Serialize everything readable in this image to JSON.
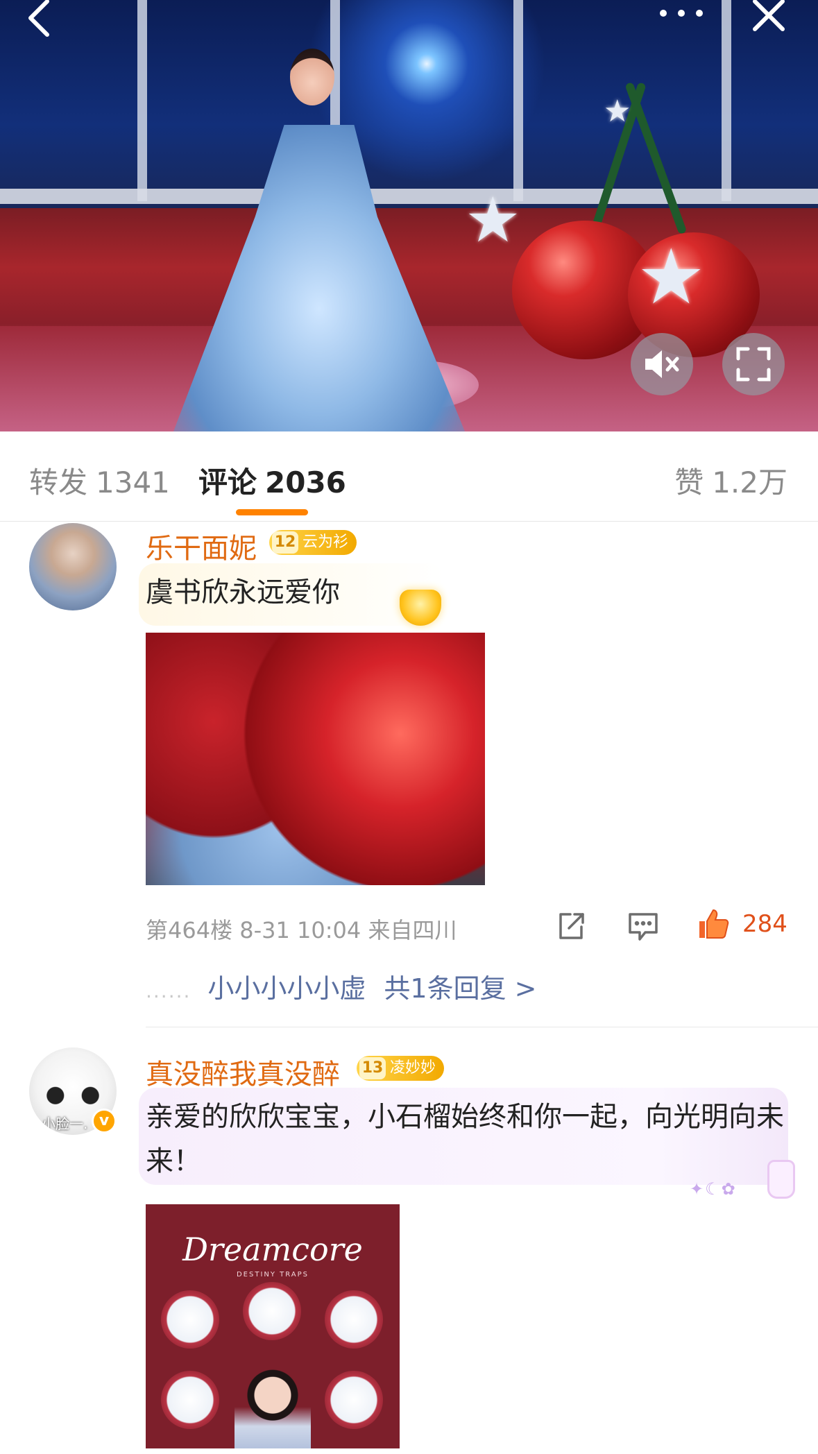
{
  "top_bar": {
    "back_icon": "chevron-left-icon",
    "more_icon": "more-horizontal-icon",
    "close_icon": "close-icon"
  },
  "media_controls": {
    "mute_icon": "speaker-muted-icon",
    "fullscreen_icon": "fullscreen-icon"
  },
  "tabs": {
    "repost": {
      "label": "转发",
      "count": "1341"
    },
    "comments": {
      "label": "评论",
      "count": "2036"
    },
    "likes": {
      "label": "赞",
      "count": "1.2万"
    },
    "accent_color": "#ff8200"
  },
  "comments": [
    {
      "username": "乐干面妮",
      "badge_level": "12",
      "badge_name": "云为衫",
      "text": "虞书欣永远爱你",
      "meta": "第464楼 8-31 10:04 来自四川",
      "like_count": "284",
      "reply_preview": {
        "dots": "......",
        "name": "小小小小小虚",
        "summary": "共1条回复 >"
      }
    },
    {
      "username": "真没醉我真没醉",
      "badge_level": "13",
      "badge_name": "凌妙妙",
      "avatar_caption": "小脸一.",
      "text": "亲爱的欣欣宝宝，小石榴始终和你一起，向光明向未来！",
      "image_title": "Dreamcore",
      "image_subtitle": "DESTINY TRAPS"
    }
  ],
  "colors": {
    "username": "#e06a12",
    "like_active": "#e0501a",
    "reply_link": "#5a6fa0",
    "meta_text": "#9a9a9a"
  }
}
